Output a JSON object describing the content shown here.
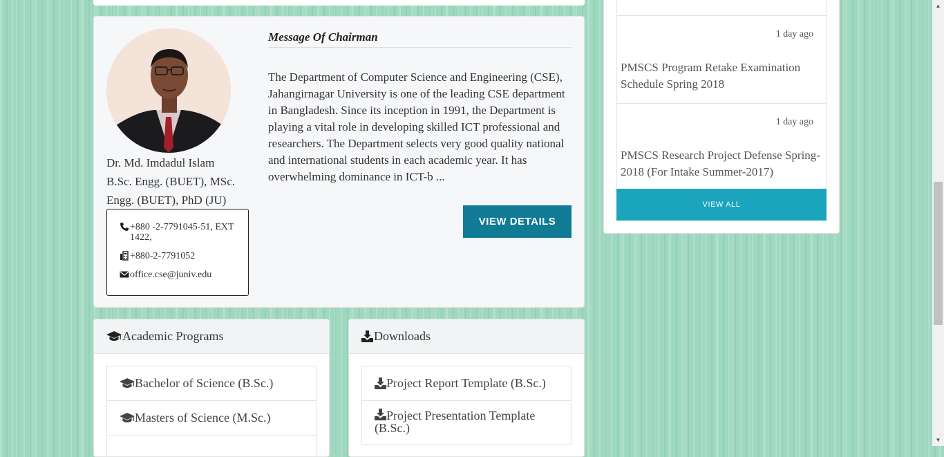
{
  "chairman": {
    "section_title": "Message Of Chairman",
    "name": "Dr. Md. Imdadul Islam",
    "degrees": "B.Sc. Engg. (BUET), MSc. Engg. (BUET), PhD (JU)",
    "phone": "+880 -2-7791045-51, EXT 1422,",
    "fax": "+880-2-7791052",
    "email": "office.cse@juniv.edu",
    "message": "The Department of Computer Science and Engineering (CSE), Jahangirnagar University is one of the leading CSE department in Bangladesh. Since its inception in 1991, the Department is playing a vital role in developing skilled ICT professional and researchers. The Department selects very good quality national and international students in each academic year. It has overwhelming dominance in ICT-b ...",
    "view_details_label": "VIEW DETAILS"
  },
  "notices": {
    "items": [
      {
        "time": "1 day ago",
        "title": "PMSCS Program Retake Examination Schedule Spring 2018"
      },
      {
        "time": "1 day ago",
        "title": "PMSCS Research Project Defense Spring-2018 (For Intake Summer-2017)"
      }
    ],
    "view_all_label": "VIEW ALL"
  },
  "academic_programs": {
    "title": "Academic Programs",
    "items": [
      "Bachelor of Science (B.Sc.)",
      "Masters of Science (M.Sc.)"
    ]
  },
  "downloads": {
    "title": "Downloads",
    "items": [
      "Project Report Template (B.Sc.)",
      "Project Presentation Template (B.Sc.)"
    ]
  },
  "icons": {
    "phone": "phone-icon",
    "fax": "fax-icon",
    "email": "envelope-icon",
    "program": "graduation-cap-icon",
    "download": "download-icon"
  },
  "colors": {
    "view_details_bg": "#117a94",
    "view_all_bg": "#1aa5bd",
    "page_bg": "#9fd8c0"
  }
}
